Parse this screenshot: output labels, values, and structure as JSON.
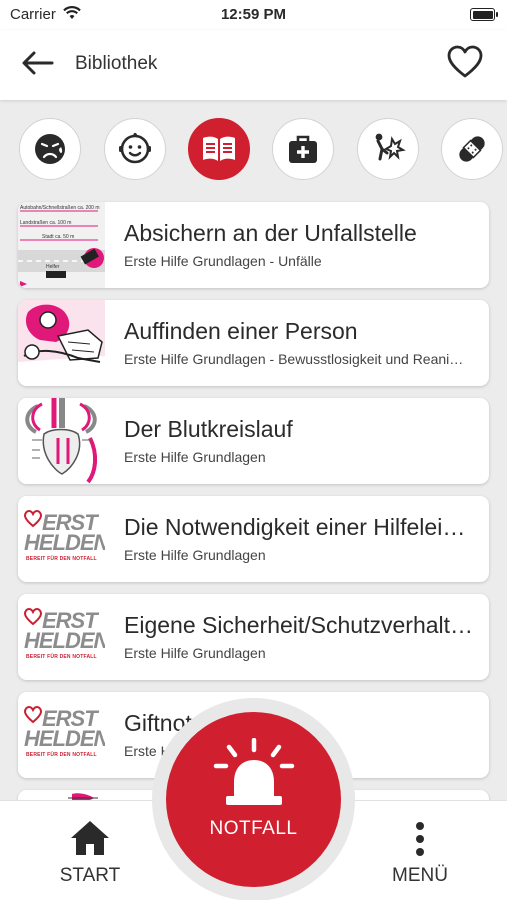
{
  "status_bar": {
    "carrier": "Carrier",
    "time": "12:59 PM"
  },
  "header": {
    "title": "Bibliothek",
    "back_icon": "arrow-left-icon",
    "favorite_icon": "heart-outline-icon"
  },
  "categories": [
    {
      "name": "emergency-face",
      "icon": "distressed-face-icon",
      "active": false
    },
    {
      "name": "baby",
      "icon": "baby-face-icon",
      "active": false
    },
    {
      "name": "library",
      "icon": "open-book-icon",
      "active": true
    },
    {
      "name": "first-aid-kit",
      "icon": "medical-bag-icon",
      "active": false
    },
    {
      "name": "injury",
      "icon": "impact-injury-icon",
      "active": false
    },
    {
      "name": "bandage",
      "icon": "bandage-icon",
      "active": false
    }
  ],
  "items": [
    {
      "title": "Absichern an der Unfallstelle",
      "subtitle": "Erste Hilfe Grundlagen - Unfälle",
      "thumb": "diagram",
      "diagram_labels": [
        "Autobahn/Schnellstraßen ca. 200 m",
        "Landstraßen ca. 100 m",
        "Stadt ca. 50 m",
        "Helfer"
      ]
    },
    {
      "title": "Auffinden einer Person",
      "subtitle": "Erste Hilfe Grundlagen - Bewusstlosigkeit und Reanimation",
      "thumb": "illustration"
    },
    {
      "title": "Der Blutkreislauf",
      "subtitle": "Erste Hilfe Grundlagen",
      "thumb": "circulation"
    },
    {
      "title": "Die Notwendigkeit einer Hilfeleistung",
      "subtitle": "Erste Hilfe Grundlagen",
      "thumb": "logo"
    },
    {
      "title": "Eigene Sicherheit/Schutzverhalten",
      "subtitle": "Erste Hilfe Grundlagen",
      "thumb": "logo"
    },
    {
      "title": "Giftnotruf",
      "subtitle": "Erste Hilfe Grundlagen",
      "thumb": "logo"
    },
    {
      "title": "",
      "subtitle": "",
      "thumb": "illustration"
    }
  ],
  "logo": {
    "line1": "ERST",
    "line2": "HELDEN",
    "tagline": "BEREIT FÜR DEN NOTFALL"
  },
  "bottom_nav": {
    "start_label": "START",
    "menu_label": "MENÜ",
    "notfall_label": "NOTFALL"
  },
  "colors": {
    "accent": "#d01f2f",
    "magenta": "#e0187a",
    "background": "#ececec"
  }
}
